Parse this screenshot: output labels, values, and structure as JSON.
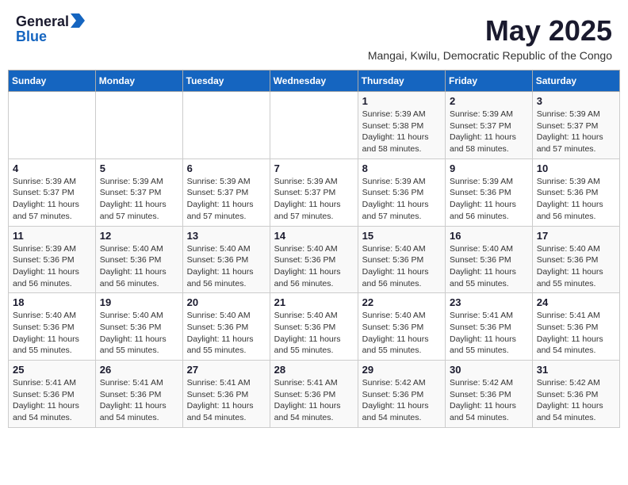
{
  "header": {
    "logo_general": "General",
    "logo_blue": "Blue",
    "month_title": "May 2025",
    "subtitle": "Mangai, Kwilu, Democratic Republic of the Congo"
  },
  "days_of_week": [
    "Sunday",
    "Monday",
    "Tuesday",
    "Wednesday",
    "Thursday",
    "Friday",
    "Saturday"
  ],
  "weeks": [
    [
      {
        "day": "",
        "info": ""
      },
      {
        "day": "",
        "info": ""
      },
      {
        "day": "",
        "info": ""
      },
      {
        "day": "",
        "info": ""
      },
      {
        "day": "1",
        "info": "Sunrise: 5:39 AM\nSunset: 5:38 PM\nDaylight: 11 hours and 58 minutes."
      },
      {
        "day": "2",
        "info": "Sunrise: 5:39 AM\nSunset: 5:37 PM\nDaylight: 11 hours and 58 minutes."
      },
      {
        "day": "3",
        "info": "Sunrise: 5:39 AM\nSunset: 5:37 PM\nDaylight: 11 hours and 57 minutes."
      }
    ],
    [
      {
        "day": "4",
        "info": "Sunrise: 5:39 AM\nSunset: 5:37 PM\nDaylight: 11 hours and 57 minutes."
      },
      {
        "day": "5",
        "info": "Sunrise: 5:39 AM\nSunset: 5:37 PM\nDaylight: 11 hours and 57 minutes."
      },
      {
        "day": "6",
        "info": "Sunrise: 5:39 AM\nSunset: 5:37 PM\nDaylight: 11 hours and 57 minutes."
      },
      {
        "day": "7",
        "info": "Sunrise: 5:39 AM\nSunset: 5:37 PM\nDaylight: 11 hours and 57 minutes."
      },
      {
        "day": "8",
        "info": "Sunrise: 5:39 AM\nSunset: 5:36 PM\nDaylight: 11 hours and 57 minutes."
      },
      {
        "day": "9",
        "info": "Sunrise: 5:39 AM\nSunset: 5:36 PM\nDaylight: 11 hours and 56 minutes."
      },
      {
        "day": "10",
        "info": "Sunrise: 5:39 AM\nSunset: 5:36 PM\nDaylight: 11 hours and 56 minutes."
      }
    ],
    [
      {
        "day": "11",
        "info": "Sunrise: 5:39 AM\nSunset: 5:36 PM\nDaylight: 11 hours and 56 minutes."
      },
      {
        "day": "12",
        "info": "Sunrise: 5:40 AM\nSunset: 5:36 PM\nDaylight: 11 hours and 56 minutes."
      },
      {
        "day": "13",
        "info": "Sunrise: 5:40 AM\nSunset: 5:36 PM\nDaylight: 11 hours and 56 minutes."
      },
      {
        "day": "14",
        "info": "Sunrise: 5:40 AM\nSunset: 5:36 PM\nDaylight: 11 hours and 56 minutes."
      },
      {
        "day": "15",
        "info": "Sunrise: 5:40 AM\nSunset: 5:36 PM\nDaylight: 11 hours and 56 minutes."
      },
      {
        "day": "16",
        "info": "Sunrise: 5:40 AM\nSunset: 5:36 PM\nDaylight: 11 hours and 55 minutes."
      },
      {
        "day": "17",
        "info": "Sunrise: 5:40 AM\nSunset: 5:36 PM\nDaylight: 11 hours and 55 minutes."
      }
    ],
    [
      {
        "day": "18",
        "info": "Sunrise: 5:40 AM\nSunset: 5:36 PM\nDaylight: 11 hours and 55 minutes."
      },
      {
        "day": "19",
        "info": "Sunrise: 5:40 AM\nSunset: 5:36 PM\nDaylight: 11 hours and 55 minutes."
      },
      {
        "day": "20",
        "info": "Sunrise: 5:40 AM\nSunset: 5:36 PM\nDaylight: 11 hours and 55 minutes."
      },
      {
        "day": "21",
        "info": "Sunrise: 5:40 AM\nSunset: 5:36 PM\nDaylight: 11 hours and 55 minutes."
      },
      {
        "day": "22",
        "info": "Sunrise: 5:40 AM\nSunset: 5:36 PM\nDaylight: 11 hours and 55 minutes."
      },
      {
        "day": "23",
        "info": "Sunrise: 5:41 AM\nSunset: 5:36 PM\nDaylight: 11 hours and 55 minutes."
      },
      {
        "day": "24",
        "info": "Sunrise: 5:41 AM\nSunset: 5:36 PM\nDaylight: 11 hours and 54 minutes."
      }
    ],
    [
      {
        "day": "25",
        "info": "Sunrise: 5:41 AM\nSunset: 5:36 PM\nDaylight: 11 hours and 54 minutes."
      },
      {
        "day": "26",
        "info": "Sunrise: 5:41 AM\nSunset: 5:36 PM\nDaylight: 11 hours and 54 minutes."
      },
      {
        "day": "27",
        "info": "Sunrise: 5:41 AM\nSunset: 5:36 PM\nDaylight: 11 hours and 54 minutes."
      },
      {
        "day": "28",
        "info": "Sunrise: 5:41 AM\nSunset: 5:36 PM\nDaylight: 11 hours and 54 minutes."
      },
      {
        "day": "29",
        "info": "Sunrise: 5:42 AM\nSunset: 5:36 PM\nDaylight: 11 hours and 54 minutes."
      },
      {
        "day": "30",
        "info": "Sunrise: 5:42 AM\nSunset: 5:36 PM\nDaylight: 11 hours and 54 minutes."
      },
      {
        "day": "31",
        "info": "Sunrise: 5:42 AM\nSunset: 5:36 PM\nDaylight: 11 hours and 54 minutes."
      }
    ]
  ]
}
